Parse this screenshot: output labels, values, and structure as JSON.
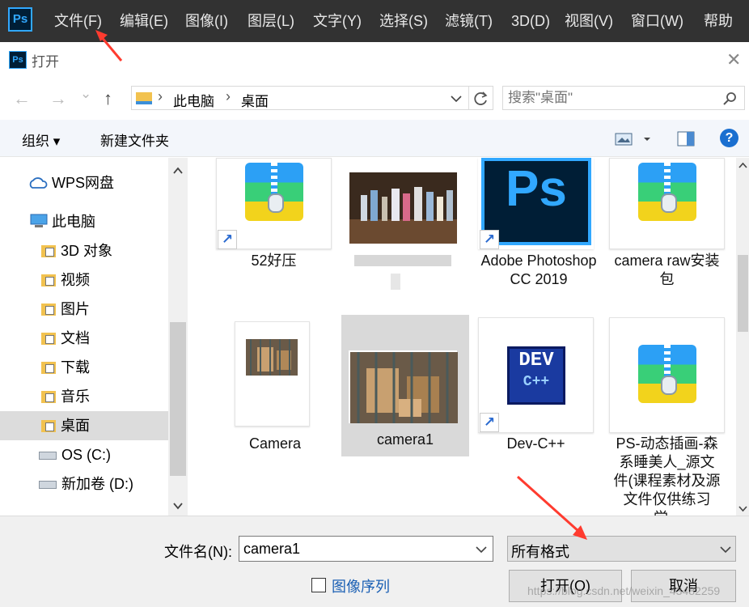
{
  "app": {
    "logo": "Ps",
    "menu": [
      "文件(F)",
      "编辑(E)",
      "图像(I)",
      "图层(L)",
      "文字(Y)",
      "选择(S)",
      "滤镜(T)",
      "3D(D)",
      "视图(V)",
      "窗口(W)",
      "帮助"
    ]
  },
  "dialog": {
    "title": "打开",
    "close": "✕",
    "nav": {
      "back": "←",
      "forward": "→",
      "recent": "⌄",
      "up": "↑"
    },
    "address": [
      "此电脑",
      "桌面"
    ],
    "address_sep": "›",
    "search_placeholder": "搜索\"桌面\"",
    "toolbar": {
      "organize": "组织 ▾",
      "new_folder": "新建文件夹",
      "help": "?"
    },
    "sidebar": [
      {
        "label": "WPS网盘"
      },
      {
        "label": "此电脑"
      },
      {
        "label": "3D 对象"
      },
      {
        "label": "视频"
      },
      {
        "label": "图片"
      },
      {
        "label": "文档"
      },
      {
        "label": "下载"
      },
      {
        "label": "音乐"
      },
      {
        "label": "桌面"
      },
      {
        "label": "OS (C:)"
      },
      {
        "label": "新加卷 (D:)"
      }
    ],
    "files": [
      {
        "name": "52好压"
      },
      {
        "name": ""
      },
      {
        "name": "Adobe Photoshop CC 2019"
      },
      {
        "name": "camera raw安装包"
      },
      {
        "name": "Camera"
      },
      {
        "name": "camera1"
      },
      {
        "name": "Dev-C++"
      },
      {
        "name": "PS-动态插画-森系睡美人_源文件(课程素材及源文件仅供练习学..."
      }
    ],
    "filename_label": "文件名(N):",
    "filename_value": "camera1",
    "filetype_value": "所有格式",
    "image_sequence_label": "图像序列",
    "open_button": "打开(O)",
    "cancel_button": "取消",
    "watermark": "https://blog.csdn.net/weixin_43482259",
    "dev_icon_text": [
      "DEV",
      "C++"
    ]
  },
  "colors": {
    "menubar": "#323232",
    "ps_blue": "#31a8ff",
    "ps_dark": "#001e36",
    "selection": "#d9d9d9",
    "arrow": "#ff3b2f"
  }
}
